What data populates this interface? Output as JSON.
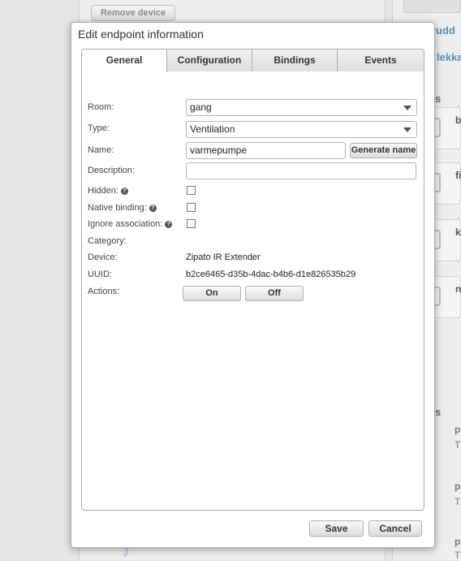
{
  "background": {
    "remove_device_label": "Remove device",
    "right_texts": [
      "rudd",
      "lekka",
      "s",
      "s"
    ],
    "card_letters": [
      "b",
      "fi",
      "k",
      "n"
    ],
    "small_letters": [
      "p",
      "T",
      "p",
      "T",
      "p",
      "T"
    ]
  },
  "dialog": {
    "title": "Edit endpoint information",
    "tabs": [
      {
        "label": "General",
        "active": true
      },
      {
        "label": "Configuration",
        "active": false
      },
      {
        "label": "Bindings",
        "active": false
      },
      {
        "label": "Events",
        "active": false
      }
    ],
    "general": {
      "room": {
        "label": "Room:",
        "value": "gang"
      },
      "type": {
        "label": "Type:",
        "value": "Ventilation"
      },
      "name": {
        "label": "Name:",
        "value": "varmepumpe",
        "generate_label": "Generate name"
      },
      "description": {
        "label": "Description:",
        "value": ""
      },
      "hidden": {
        "label": "Hidden:",
        "checked": false
      },
      "native_binding": {
        "label": "Native binding:",
        "checked": false
      },
      "ignore_association": {
        "label": "Ignore association:",
        "checked": false
      },
      "category": {
        "label": "Category:",
        "value": ""
      },
      "device": {
        "label": "Device:",
        "value": "Zipato IR Extender"
      },
      "uuid": {
        "label": "UUID:",
        "value": "b2ce6465-d35b-4dac-b4b6-d1e826535b29"
      },
      "actions": {
        "label": "Actions:",
        "on_label": "On",
        "off_label": "Off"
      }
    },
    "footer": {
      "save_label": "Save",
      "cancel_label": "Cancel"
    }
  }
}
